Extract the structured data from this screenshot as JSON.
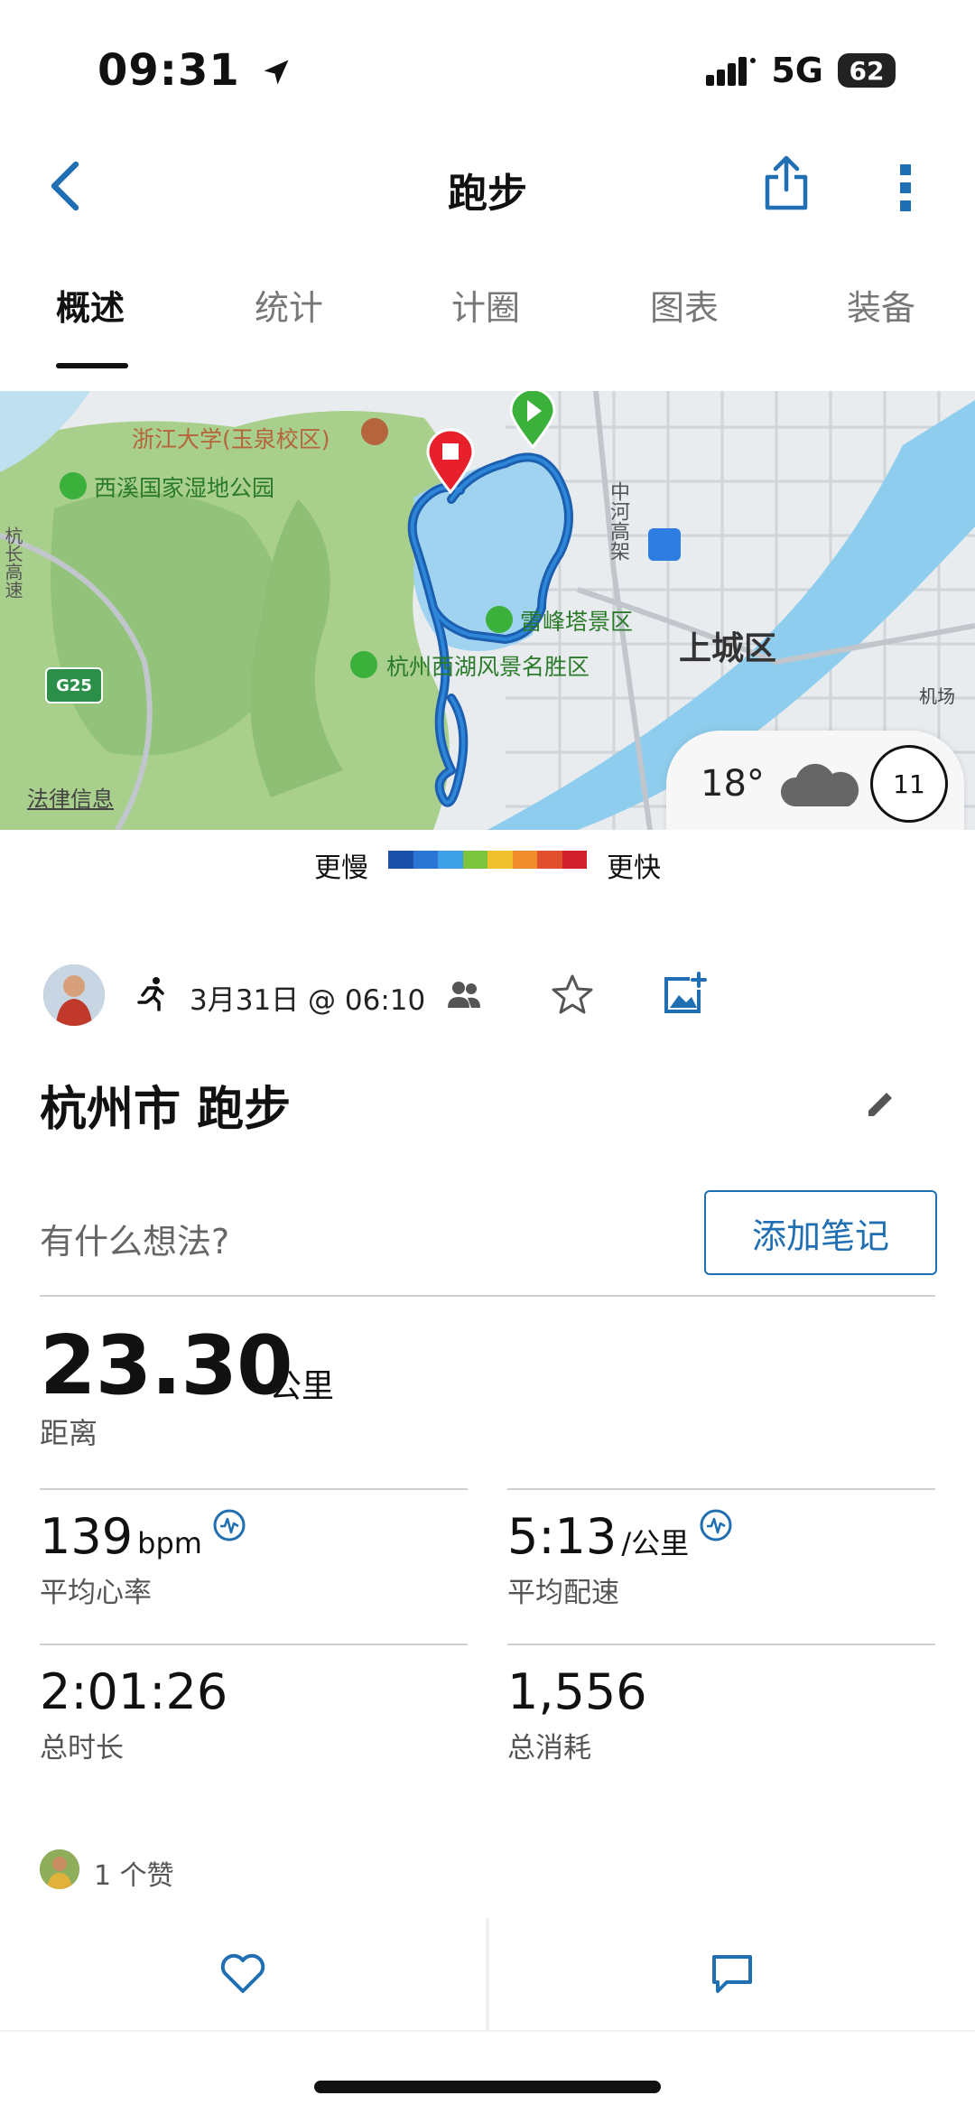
{
  "status": {
    "time": "09:31",
    "network": "5G",
    "battery": "62"
  },
  "header": {
    "title": "跑步"
  },
  "tabs": [
    {
      "label": "概述"
    },
    {
      "label": "统计"
    },
    {
      "label": "计圈"
    },
    {
      "label": "图表"
    },
    {
      "label": "装备"
    }
  ],
  "map": {
    "labels": {
      "university": "浙江大学(玉泉校区)",
      "wetland": "西溪国家湿地公园",
      "leifeng": "雷峰塔景区",
      "westlake": "杭州西湖风景名胜区",
      "district": "上城区",
      "road_vertical": "中河高架",
      "road_left": "杭长高速",
      "highway": "G25",
      "airport": "机场",
      "legal": "法律信息"
    },
    "weather": {
      "temp": "18°",
      "wind": "11"
    }
  },
  "legend": {
    "slow": "更慢",
    "fast": "更快",
    "colors": [
      "#1b4fa8",
      "#2a74d4",
      "#3ea0e6",
      "#7cc43c",
      "#f0c02c",
      "#f08c2c",
      "#e0502c",
      "#d0202c"
    ]
  },
  "activity": {
    "date": "3月31日 @ 06:10",
    "title": "杭州市 跑步",
    "note_placeholder": "有什么想法?",
    "add_note": "添加笔记",
    "distance": {
      "value": "23.30",
      "unit": "公里",
      "label": "距离"
    },
    "heart_rate": {
      "value": "139",
      "unit": "bpm",
      "label": "平均心率"
    },
    "pace": {
      "value": "5:13",
      "unit": "/公里",
      "label": "平均配速"
    },
    "duration": {
      "value": "2:01:26",
      "label": "总时长"
    },
    "calories": {
      "value": "1,556",
      "label": "总消耗"
    }
  },
  "likes": {
    "text": "1 个赞"
  },
  "colors": {
    "accent": "#1f6fb2",
    "route": "#1c5fb0",
    "water": "#9fd3ef",
    "park": "#a8cf8a"
  }
}
